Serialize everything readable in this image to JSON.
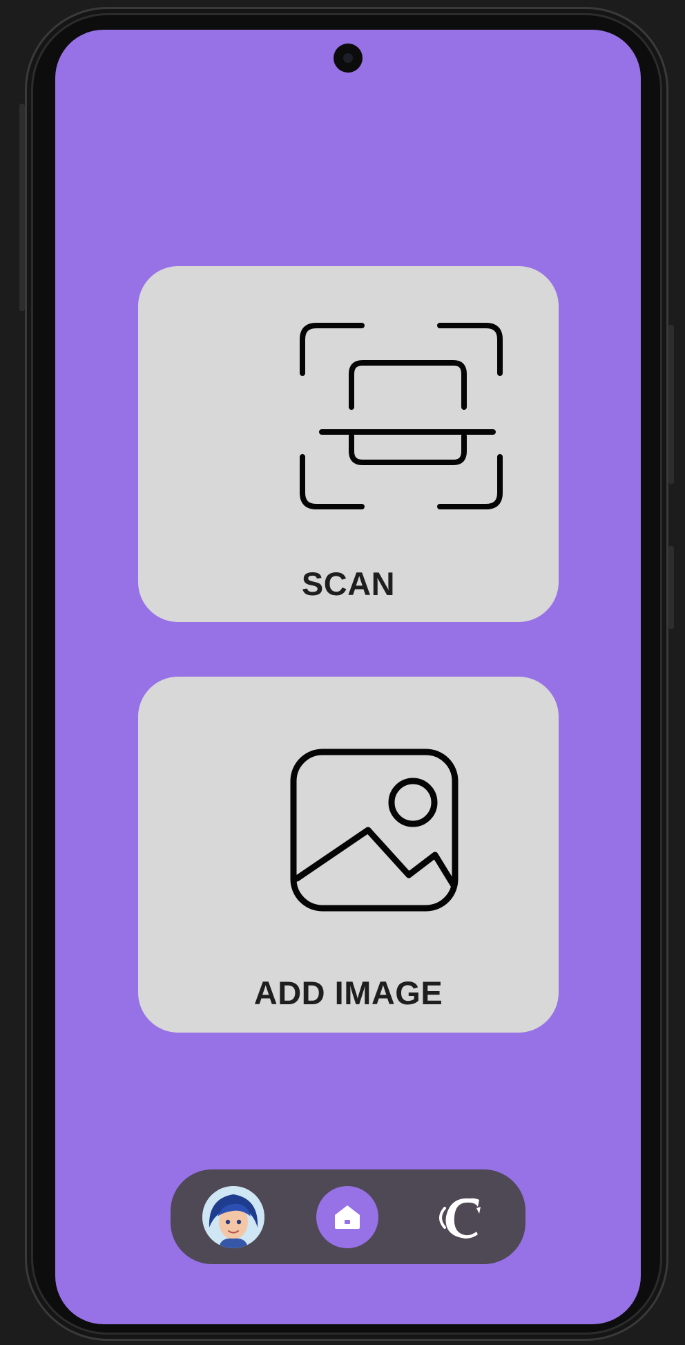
{
  "scan_card": {
    "label": "SCAN",
    "icon": "document-scanner-icon"
  },
  "add_image_card": {
    "label": "ADD IMAGE",
    "icon": "image-icon"
  },
  "bottom_nav": {
    "items": [
      {
        "name": "profile",
        "icon": "avatar"
      },
      {
        "name": "home",
        "icon": "home-icon",
        "active": true
      },
      {
        "name": "brand",
        "icon": "logo-icon"
      }
    ]
  },
  "colors": {
    "screen_background": "#9771e6",
    "card_background": "#d8d8d8",
    "nav_background": "#4f4855",
    "accent": "#9771e6"
  }
}
